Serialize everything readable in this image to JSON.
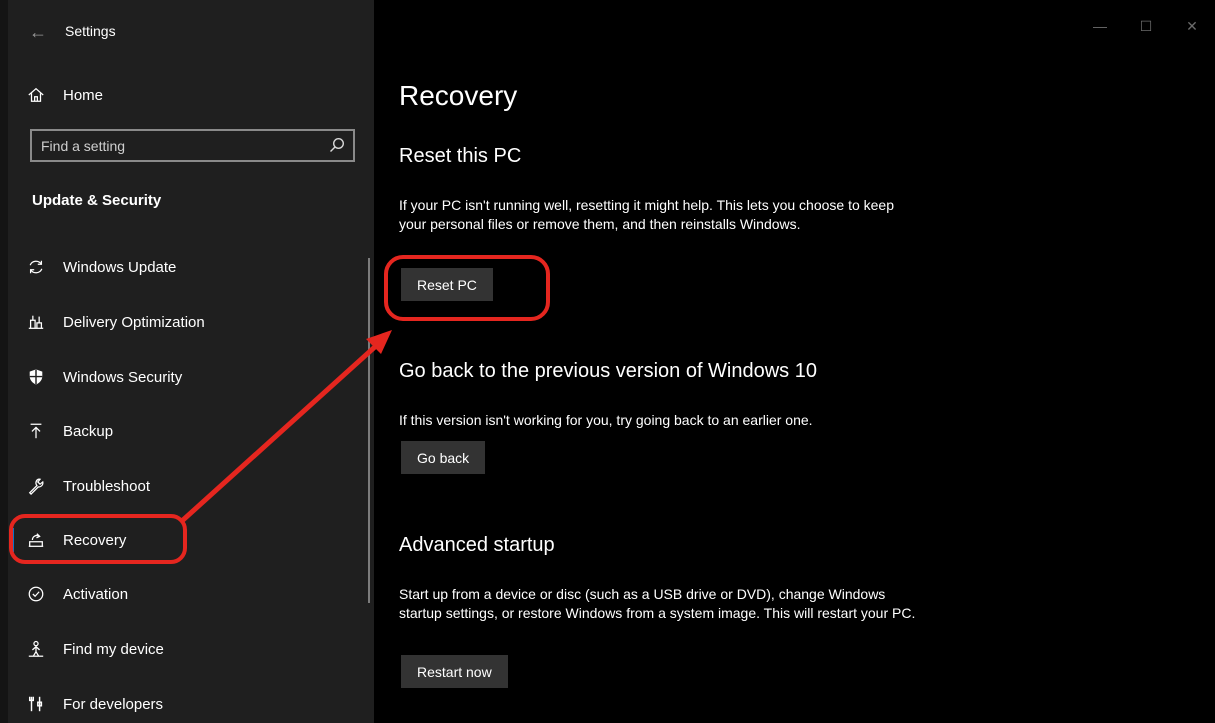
{
  "window": {
    "app_title": "Settings",
    "caption": {
      "minimize": "—",
      "maximize": "☐",
      "close": "✕"
    }
  },
  "sidebar": {
    "home_label": "Home",
    "search": {
      "placeholder": "Find a setting"
    },
    "section_title": "Update & Security",
    "items": [
      {
        "label": "Windows Update",
        "icon": "sync-icon"
      },
      {
        "label": "Delivery Optimization",
        "icon": "delivery-optimization-icon"
      },
      {
        "label": "Windows Security",
        "icon": "shield-icon"
      },
      {
        "label": "Backup",
        "icon": "backup-arrow-icon"
      },
      {
        "label": "Troubleshoot",
        "icon": "wrench-icon"
      },
      {
        "label": "Recovery",
        "icon": "recovery-icon",
        "selected": true
      },
      {
        "label": "Activation",
        "icon": "check-circle-icon"
      },
      {
        "label": "Find my device",
        "icon": "person-location-icon"
      },
      {
        "label": "For developers",
        "icon": "developer-tools-icon"
      }
    ]
  },
  "main": {
    "title": "Recovery",
    "reset": {
      "heading": "Reset this PC",
      "description": "If your PC isn't running well, resetting it might help. This lets you choose to keep your personal files or remove them, and then reinstalls Windows.",
      "button": "Reset PC"
    },
    "goback": {
      "heading": "Go back to the previous version of Windows 10",
      "description": "If this version isn't working for you, try going back to an earlier one.",
      "button": "Go back"
    },
    "advanced": {
      "heading": "Advanced startup",
      "description": "Start up from a device or disc (such as a USB drive or DVD), change Windows startup settings, or restore Windows from a system image. This will restart your PC.",
      "button": "Restart now"
    }
  },
  "colors": {
    "sidebar_bg": "#1f1f1f",
    "content_bg": "#000000",
    "button_bg": "#333333",
    "accent": "#0a74c8",
    "annotation": "#e5261f"
  }
}
